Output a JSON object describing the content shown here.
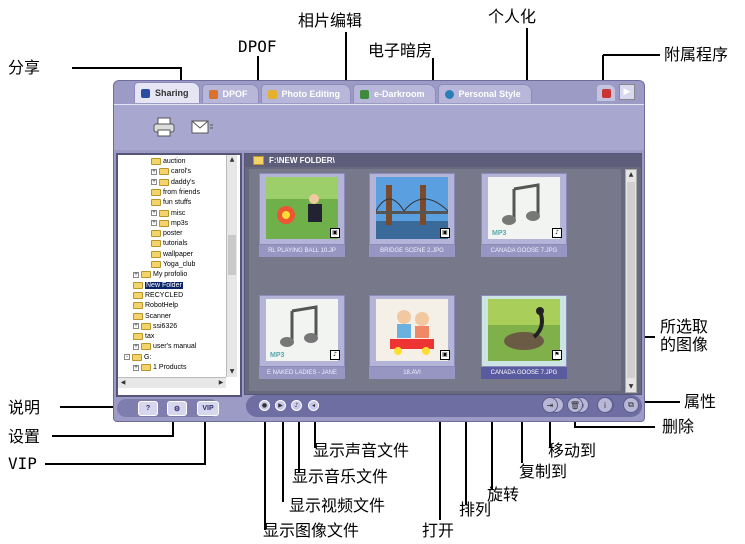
{
  "callouts": {
    "share": "分享",
    "dpof": "DPOF",
    "photo_editing": "相片编辑",
    "e_darkroom": "电子暗房",
    "personal_style": "个人化",
    "accessories": "附属程序",
    "selected_image": "所选取\n的图像",
    "properties": "属性",
    "delete": "删除",
    "move_to": "移动到",
    "copy_to": "复制到",
    "rotate": "旋转",
    "sort": "排列",
    "open": "打开",
    "show_audio": "显示声音文件",
    "show_music": "显示音乐文件",
    "show_video": "显示视频文件",
    "show_image": "显示图像文件",
    "help": "说明",
    "settings": "设置",
    "vip": "VIP"
  },
  "tabs": [
    {
      "label": "Sharing",
      "active": true,
      "icon": "sharing-icon",
      "color": "#2b4ea3"
    },
    {
      "label": "DPOF",
      "active": false,
      "icon": "printer-icon",
      "color": "#d9722b"
    },
    {
      "label": "Photo Editing",
      "active": false,
      "icon": "pencil-icon",
      "color": "#e5b02b"
    },
    {
      "label": "e-Darkroom",
      "active": false,
      "icon": "film-icon",
      "color": "#3e8b3e"
    },
    {
      "label": "Personal Style",
      "active": false,
      "icon": "palette-icon",
      "color": "#2b7fb9"
    }
  ],
  "toolbar": {
    "print_icon": "printer-icon",
    "email_icon": "envelope-icon"
  },
  "path": "F:\\NEW FOLDER\\",
  "tree": [
    {
      "label": "auction",
      "indent": 3,
      "expander": ""
    },
    {
      "label": "carol's",
      "indent": 3,
      "expander": "+"
    },
    {
      "label": "daddy's",
      "indent": 3,
      "expander": "+"
    },
    {
      "label": "from friends",
      "indent": 3,
      "expander": ""
    },
    {
      "label": "fun stuffs",
      "indent": 3,
      "expander": ""
    },
    {
      "label": "misc",
      "indent": 3,
      "expander": "+"
    },
    {
      "label": "mp3s",
      "indent": 3,
      "expander": "+"
    },
    {
      "label": "poster",
      "indent": 3,
      "expander": ""
    },
    {
      "label": "tutorials",
      "indent": 3,
      "expander": ""
    },
    {
      "label": "wallpaper",
      "indent": 3,
      "expander": ""
    },
    {
      "label": "Yoga_club",
      "indent": 3,
      "expander": ""
    },
    {
      "label": "My profolio",
      "indent": 1,
      "expander": "+"
    },
    {
      "label": "New Folder",
      "indent": 1,
      "expander": "",
      "selected": true
    },
    {
      "label": "RECYCLED",
      "indent": 1,
      "expander": ""
    },
    {
      "label": "RobotHelp",
      "indent": 1,
      "expander": ""
    },
    {
      "label": "Scanner",
      "indent": 1,
      "expander": ""
    },
    {
      "label": "ssi6326",
      "indent": 1,
      "expander": "+"
    },
    {
      "label": "tax",
      "indent": 1,
      "expander": ""
    },
    {
      "label": "user's manual",
      "indent": 1,
      "expander": "+"
    },
    {
      "label": "G:",
      "indent": 0,
      "expander": "-"
    },
    {
      "label": "1 Products",
      "indent": 1,
      "expander": "+"
    }
  ],
  "thumbnails": [
    {
      "caption": "RL PLAYING BALL 10.JP",
      "kind": "photo-kids-ball",
      "badge": "▣",
      "selected": false
    },
    {
      "caption": "BRIDGE SCENE 2.JPG",
      "kind": "photo-bridge",
      "badge": "▣",
      "selected": false
    },
    {
      "caption": "CANADA GOOSE 7.JPG",
      "kind": "music-note",
      "badge": "♪",
      "selected": false
    },
    {
      "caption": "E NAKED LADIES - JANE",
      "kind": "music-note",
      "badge": "♪",
      "selected": false
    },
    {
      "caption": "18.AVI",
      "kind": "photo-toddlers",
      "badge": "▣",
      "selected": false
    },
    {
      "caption": "CANADA GOOSE 7.JPG",
      "kind": "photo-goose",
      "badge": "⚑",
      "selected": true
    }
  ],
  "left_buttons": {
    "help": "?",
    "settings": "⚙",
    "vip": "VIP"
  },
  "mp3_text": "MP3"
}
